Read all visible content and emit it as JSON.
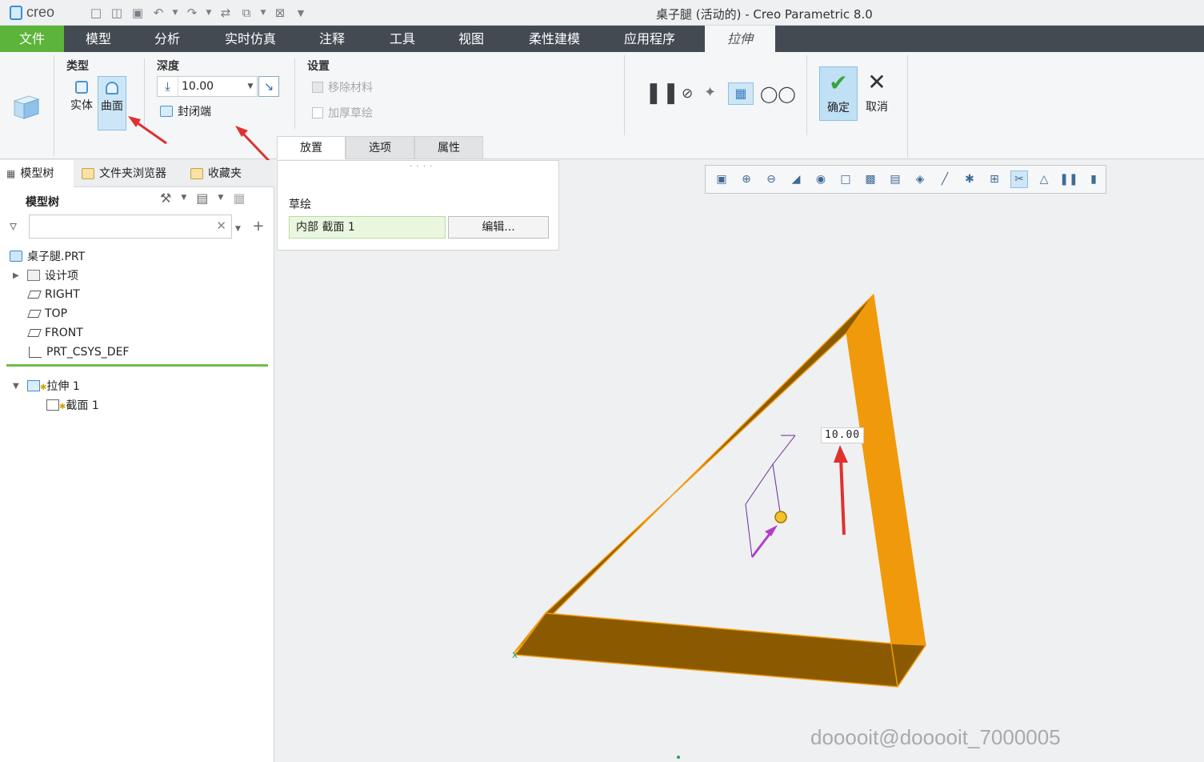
{
  "window": {
    "logo_text": "creo",
    "title": "桌子腿 (活动的) - Creo Parametric 8.0"
  },
  "ribbon_tabs": [
    "文件",
    "模型",
    "分析",
    "实时仿真",
    "注释",
    "工具",
    "视图",
    "柔性建模",
    "应用程序",
    "拉伸"
  ],
  "ribbon": {
    "type_group": {
      "title": "类型",
      "solid": "实体",
      "surface": "曲面"
    },
    "depth_group": {
      "title": "深度",
      "value": "10.00",
      "cap_ends": "封闭端"
    },
    "settings_group": {
      "title": "设置",
      "remove_material": "移除材料",
      "thicken_sketch": "加厚草绘"
    },
    "confirm": "确定",
    "cancel": "取消",
    "subtabs": [
      "放置",
      "选项",
      "属性"
    ]
  },
  "left_panel": {
    "tabs": [
      "模型树",
      "文件夹浏览器",
      "收藏夹"
    ],
    "tree_header": "模型树",
    "search_placeholder": "",
    "nodes": [
      "桌子腿.PRT",
      "设计项",
      "RIGHT",
      "TOP",
      "FRONT",
      "PRT_CSYS_DEF",
      "拉伸 1",
      "截面 1"
    ]
  },
  "placement": {
    "label": "草绘",
    "section_value": "内部 截面 1",
    "edit_button": "编辑..."
  },
  "graphics": {
    "dimension_label": "10.00",
    "watermark": "dooooit@dooooit_7000005",
    "surface_color": "#f09a0b",
    "surface_dark": "#8b5a00"
  }
}
